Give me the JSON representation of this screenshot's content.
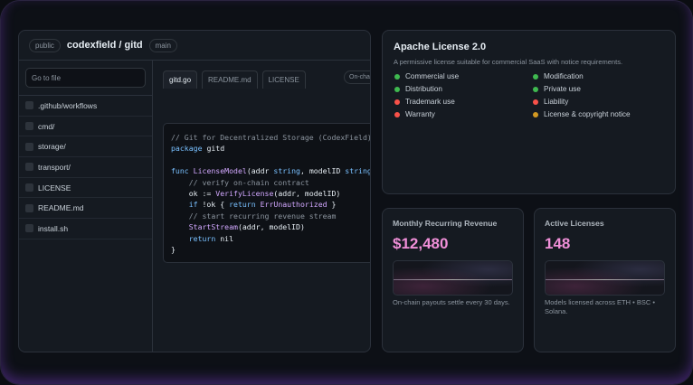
{
  "repo": {
    "visibility": "public",
    "name": "codexfield / gitd",
    "branch": "main",
    "search_placeholder": "Go to file",
    "files": [
      ".github/workflows",
      "cmd/",
      "storage/",
      "transport/",
      "LICENSE",
      "README.md",
      "install.sh"
    ],
    "tabs": [
      "gitd.go",
      "README.md",
      "LICENSE"
    ],
    "chip": "On-chain",
    "code": [
      [
        {
          "t": "// Git for Decentralized Storage (CodexField)",
          "c": "cm"
        }
      ],
      [
        {
          "t": "package",
          "c": "kw"
        },
        {
          "t": " gitd"
        }
      ],
      [
        {
          "t": ""
        }
      ],
      [
        {
          "t": "func",
          "c": "kw"
        },
        {
          "t": " "
        },
        {
          "t": "LicenseModel",
          "c": "fn"
        },
        {
          "t": "(addr "
        },
        {
          "t": "string",
          "c": "kw"
        },
        {
          "t": ", modelID "
        },
        {
          "t": "string",
          "c": "kw"
        },
        {
          "t": ") {"
        }
      ],
      [
        {
          "t": "    // verify on-chain contract",
          "c": "cm"
        }
      ],
      [
        {
          "t": "    ok := "
        },
        {
          "t": "VerifyLicense",
          "c": "fn"
        },
        {
          "t": "(addr, modelID)"
        }
      ],
      [
        {
          "t": "    "
        },
        {
          "t": "if",
          "c": "kw"
        },
        {
          "t": " !ok { "
        },
        {
          "t": "return",
          "c": "kw"
        },
        {
          "t": " "
        },
        {
          "t": "ErrUnauthorized",
          "c": "fn"
        },
        {
          "t": " }"
        }
      ],
      [
        {
          "t": "    // start recurring revenue stream",
          "c": "cm"
        }
      ],
      [
        {
          "t": "    "
        },
        {
          "t": "StartStream",
          "c": "fn"
        },
        {
          "t": "(addr, modelID)"
        }
      ],
      [
        {
          "t": "    "
        },
        {
          "t": "return",
          "c": "kw"
        },
        {
          "t": " nil"
        }
      ],
      [
        {
          "t": "}"
        }
      ]
    ]
  },
  "license": {
    "title": "Apache License 2.0",
    "description": "A permissive license suitable for commercial SaaS with notice requirements.",
    "items": [
      {
        "label": "Commercial use",
        "color": "#3fb950"
      },
      {
        "label": "Modification",
        "color": "#3fb950"
      },
      {
        "label": "Distribution",
        "color": "#3fb950"
      },
      {
        "label": "Private use",
        "color": "#3fb950"
      },
      {
        "label": "Trademark use",
        "color": "#f85149"
      },
      {
        "label": "Liability",
        "color": "#f85149"
      },
      {
        "label": "Warranty",
        "color": "#f85149"
      },
      {
        "label": "License & copyright notice",
        "color": "#d29922"
      }
    ]
  },
  "stats": [
    {
      "title": "Monthly Recurring Revenue",
      "value": "$12,480",
      "note": "On-chain payouts settle every 30 days."
    },
    {
      "title": "Active Licenses",
      "value": "148",
      "note": "Models licensed across ETH • BSC • Solana."
    }
  ]
}
